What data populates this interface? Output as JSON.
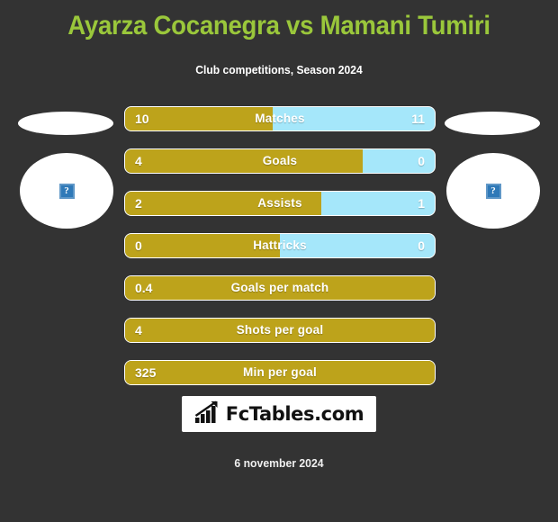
{
  "header": {
    "title": "Ayarza Cocanegra vs Mamani Tumiri",
    "subtitle": "Club competitions, Season 2024"
  },
  "colors": {
    "background": "#333333",
    "title": "#9ac73b",
    "home_bar": "#bda31b",
    "away_bar": "#a5e7fa",
    "text": "#ffffff"
  },
  "players": {
    "home": {
      "name": "",
      "photo_placeholder": "?"
    },
    "away": {
      "name": "",
      "photo_placeholder": "?"
    }
  },
  "stats": [
    {
      "label": "Matches",
      "home": "10",
      "away": "11",
      "home_pct": 47.6,
      "split": true
    },
    {
      "label": "Goals",
      "home": "4",
      "away": "0",
      "home_pct": 76.6,
      "split": true
    },
    {
      "label": "Assists",
      "home": "2",
      "away": "1",
      "home_pct": 63.3,
      "split": true
    },
    {
      "label": "Hattricks",
      "home": "0",
      "away": "0",
      "home_pct": 50.0,
      "split": true
    },
    {
      "label": "Goals per match",
      "home": "0.4",
      "away": "",
      "home_pct": 100.0,
      "split": false
    },
    {
      "label": "Shots per goal",
      "home": "4",
      "away": "",
      "home_pct": 100.0,
      "split": false
    },
    {
      "label": "Min per goal",
      "home": "325",
      "away": "",
      "home_pct": 100.0,
      "split": false
    }
  ],
  "footer": {
    "logo_text": "FcTables.com",
    "logo_icon": "bar-chart-arrow-icon",
    "date": "6 november 2024"
  }
}
